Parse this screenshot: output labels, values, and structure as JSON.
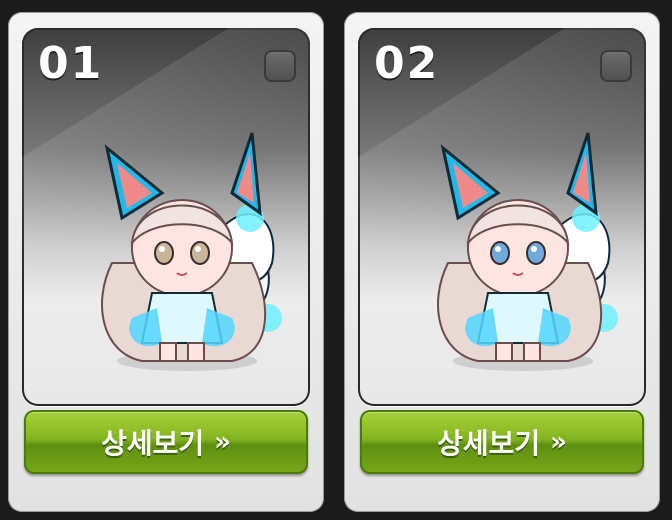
{
  "cards": [
    {
      "number": "01",
      "button_label": "상세보기",
      "button_chevron": "»",
      "eye_color": "#c8b59a"
    },
    {
      "number": "02",
      "button_label": "상세보기",
      "button_chevron": "»",
      "eye_color": "#6fa9de"
    }
  ],
  "colors": {
    "button_green": "#86b521",
    "accent_cyan": "#33d6ff"
  },
  "icons": {
    "select": "checkbox-icon",
    "more": "double-chevron-right-icon"
  }
}
